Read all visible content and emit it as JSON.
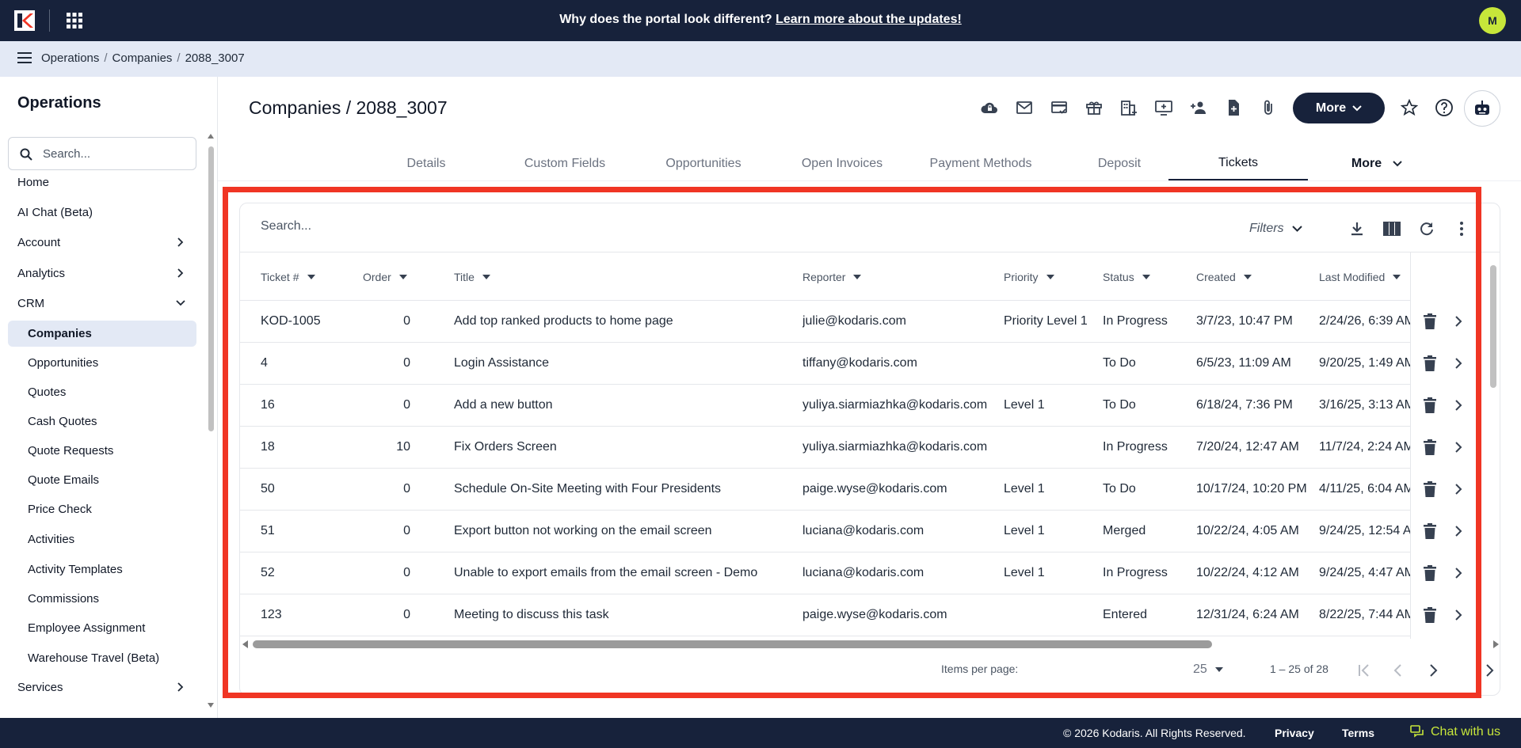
{
  "banner": {
    "question": "Why does the portal look different?",
    "link": "Learn more about the updates!"
  },
  "user": {
    "initial": "M"
  },
  "breadcrumb": [
    "Operations",
    "Companies",
    "2088_3007"
  ],
  "sidebar": {
    "title": "Operations",
    "search_placeholder": "Search...",
    "items": [
      {
        "label": "Home",
        "level": "top"
      },
      {
        "label": "AI Chat (Beta)",
        "level": "top"
      },
      {
        "label": "Account",
        "level": "top",
        "chevron": "right"
      },
      {
        "label": "Analytics",
        "level": "top",
        "chevron": "right"
      },
      {
        "label": "CRM",
        "level": "top",
        "chevron": "down"
      },
      {
        "label": "Companies",
        "level": "sub",
        "active": true
      },
      {
        "label": "Opportunities",
        "level": "sub"
      },
      {
        "label": "Quotes",
        "level": "sub"
      },
      {
        "label": "Cash Quotes",
        "level": "sub"
      },
      {
        "label": "Quote Requests",
        "level": "sub"
      },
      {
        "label": "Quote Emails",
        "level": "sub"
      },
      {
        "label": "Price Check",
        "level": "sub"
      },
      {
        "label": "Activities",
        "level": "sub"
      },
      {
        "label": "Activity Templates",
        "level": "sub"
      },
      {
        "label": "Commissions",
        "level": "sub"
      },
      {
        "label": "Employee Assignment",
        "level": "sub"
      },
      {
        "label": "Warehouse Travel (Beta)",
        "level": "sub"
      },
      {
        "label": "Services",
        "level": "top",
        "chevron": "right"
      }
    ]
  },
  "page": {
    "title": "Companies / 2088_3007",
    "more_label": "More",
    "toolbar_icons": [
      "cloud-lock-icon",
      "mail-icon",
      "card-check-icon",
      "gift-icon",
      "building-add-icon",
      "monitor-add-icon",
      "person-add-icon",
      "file-add-icon",
      "paperclip-icon"
    ]
  },
  "tabs": [
    "Details",
    "Custom Fields",
    "Opportunities",
    "Open Invoices",
    "Payment Methods",
    "Deposit",
    "Tickets",
    "More"
  ],
  "active_tab": "Tickets",
  "table": {
    "search_placeholder": "Search...",
    "filters_label": "Filters",
    "columns": [
      "Ticket #",
      "Order",
      "Title",
      "Reporter",
      "Priority",
      "Status",
      "Created",
      "Last Modified"
    ],
    "rows": [
      {
        "ticket": "KOD-1005",
        "order": "0",
        "title": "Add top ranked products to home page",
        "reporter": "julie@kodaris.com",
        "priority": "Priority Level 1",
        "status": "In Progress",
        "created": "3/7/23, 10:47 PM",
        "modified": "2/24/26, 6:39 AM"
      },
      {
        "ticket": "4",
        "order": "0",
        "title": "Login Assistance",
        "reporter": "tiffany@kodaris.com",
        "priority": "",
        "status": "To Do",
        "created": "6/5/23, 11:09 AM",
        "modified": "9/20/25, 1:49 AM"
      },
      {
        "ticket": "16",
        "order": "0",
        "title": "Add a new button",
        "reporter": "yuliya.siarmiazhka@kodaris.com",
        "priority": "Level 1",
        "status": "To Do",
        "created": "6/18/24, 7:36 PM",
        "modified": "3/16/25, 3:13 AM"
      },
      {
        "ticket": "18",
        "order": "10",
        "title": "Fix Orders Screen",
        "reporter": "yuliya.siarmiazhka@kodaris.com",
        "priority": "",
        "status": "In Progress",
        "created": "7/20/24, 12:47 AM",
        "modified": "11/7/24, 2:24 AM"
      },
      {
        "ticket": "50",
        "order": "0",
        "title": "Schedule On-Site Meeting with Four Presidents",
        "reporter": "paige.wyse@kodaris.com",
        "priority": "Level 1",
        "status": "To Do",
        "created": "10/17/24, 10:20 PM",
        "modified": "4/11/25, 6:04 AM"
      },
      {
        "ticket": "51",
        "order": "0",
        "title": "Export button not working on the email screen",
        "reporter": "luciana@kodaris.com",
        "priority": "Level 1",
        "status": "Merged",
        "created": "10/22/24, 4:05 AM",
        "modified": "9/24/25, 12:54 AM"
      },
      {
        "ticket": "52",
        "order": "0",
        "title": "Unable to export emails from the email screen - Demo",
        "reporter": "luciana@kodaris.com",
        "priority": "Level 1",
        "status": "In Progress",
        "created": "10/22/24, 4:12 AM",
        "modified": "9/24/25, 4:47 AM"
      },
      {
        "ticket": "123",
        "order": "0",
        "title": "Meeting to discuss this task",
        "reporter": "paige.wyse@kodaris.com",
        "priority": "",
        "status": "Entered",
        "created": "12/31/24, 6:24 AM",
        "modified": "8/22/25, 7:44 AM"
      }
    ],
    "items_per_page_label": "Items per page:",
    "items_per_page": "25",
    "range": "1 – 25 of 28"
  },
  "footer": {
    "copyright": "© 2026 Kodaris. All Rights Reserved.",
    "privacy": "Privacy",
    "terms": "Terms",
    "chat": "Chat with us"
  },
  "colors": {
    "navy": "#17223b",
    "accent": "#c7e63a",
    "highlight": "#f03524"
  }
}
